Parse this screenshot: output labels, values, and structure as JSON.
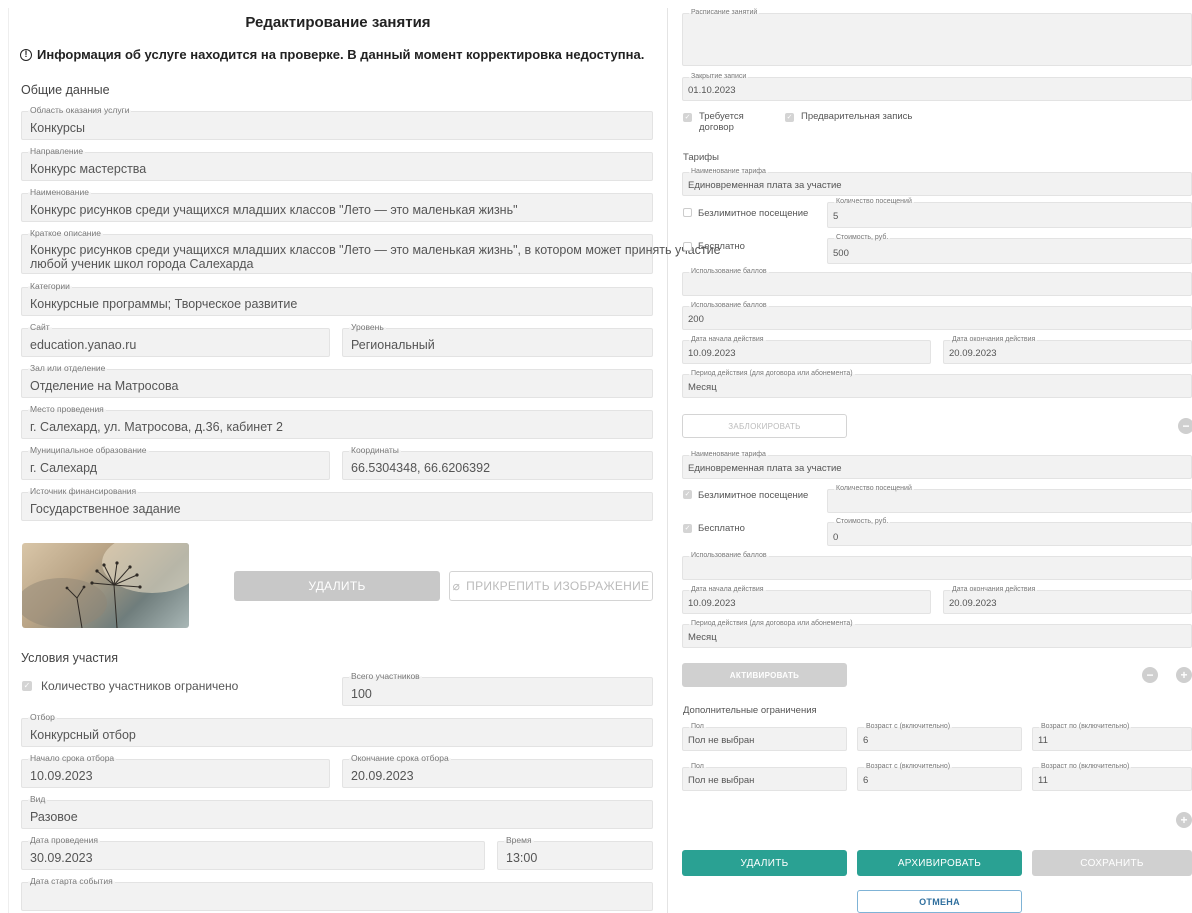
{
  "page": {
    "title": "Редактирование занятия",
    "notice": "Информация об услуге находится на проверке. В данный момент корректировка недоступна.",
    "general_section": "Общие данные",
    "conditions_section": "Условия участия"
  },
  "general": {
    "area": {
      "label": "Область оказания услуги",
      "value": "Конкурсы"
    },
    "direction": {
      "label": "Направление",
      "value": "Конкурс мастерства"
    },
    "name": {
      "label": "Наименование",
      "value": "Конкурс рисунков среди учащихся младших классов \"Лето — это маленькая жизнь\""
    },
    "short_desc": {
      "label": "Краткое описание",
      "value_line1": "Конкурс рисунков среди учащихся младших классов \"Лето — это маленькая жизнь\", в котором может принять участие",
      "value_line2": "любой ученик школ города Салехарда"
    },
    "categories": {
      "label": "Категории",
      "value": "Конкурсные программы; Творческое развитие"
    },
    "site": {
      "label": "Сайт",
      "value": "education.yanao.ru"
    },
    "level": {
      "label": "Уровень",
      "value": "Региональный"
    },
    "hall": {
      "label": "Зал или отделение",
      "value": "Отделение на Матросова"
    },
    "place": {
      "label": "Место проведения",
      "value": "г. Салехард, ул. Матросова, д.36, кабинет 2"
    },
    "municipality": {
      "label": "Муниципальное образование",
      "value": "г. Салехард"
    },
    "coords": {
      "label": "Координаты",
      "value": "66.5304348, 66.6206392"
    },
    "funding": {
      "label": "Источник финансирования",
      "value": "Государственное задание"
    }
  },
  "image_actions": {
    "delete": "УДАЛИТЬ",
    "attach": "ПРИКРЕПИТЬ ИЗОБРАЖЕНИЕ"
  },
  "conditions": {
    "limited_label": "Количество участников ограничено",
    "total": {
      "label": "Всего участников",
      "value": "100"
    },
    "selection": {
      "label": "Отбор",
      "value": "Конкурсный отбор"
    },
    "sel_start": {
      "label": "Начало срока отбора",
      "value": "10.09.2023"
    },
    "sel_end": {
      "label": "Окончание срока отбора",
      "value": "20.09.2023"
    },
    "kind": {
      "label": "Вид",
      "value": "Разовое"
    },
    "date": {
      "label": "Дата проведения",
      "value": "30.09.2023"
    },
    "time": {
      "label": "Время",
      "value": "13:00"
    },
    "start_date": {
      "label": "Дата старта события",
      "value": ""
    }
  },
  "right": {
    "schedule": {
      "label": "Расписание занятий",
      "value": ""
    },
    "close": {
      "label": "Закрытие записи",
      "value": "01.10.2023"
    },
    "contract_label_1": "Требуется",
    "contract_label_2": "договор",
    "prereg_label": "Предварительная запись",
    "tariffs_section": "Тарифы",
    "extra_section": "Дополнительные ограничения"
  },
  "tariff1": {
    "name": {
      "label": "Наименование тарифа",
      "value": "Единовременная плата за участие"
    },
    "unlimited_label": "Безлимитное посещение",
    "visits": {
      "label": "Количество посещений",
      "value": "5"
    },
    "free_label": "Бесплатно",
    "cost": {
      "label": "Стоимость, руб.",
      "value": "500"
    },
    "points_use": {
      "label": "Использование баллов",
      "value": ""
    },
    "points_use2": {
      "label": "Использование баллов",
      "value": "200"
    },
    "start": {
      "label": "Дата начала действия",
      "value": "10.09.2023"
    },
    "end": {
      "label": "Дата окончания действия",
      "value": "20.09.2023"
    },
    "period": {
      "label": "Период действия (для договора или абонемента)",
      "value": "Месяц"
    },
    "block_btn": "ЗАБЛОКИРОВАТЬ"
  },
  "tariff2": {
    "name": {
      "label": "Наименование тарифа",
      "value": "Единовременная плата за участие"
    },
    "unlimited_label": "Безлимитное посещение",
    "visits": {
      "label": "Количество посещений",
      "value": ""
    },
    "free_label": "Бесплатно",
    "cost": {
      "label": "Стоимость, руб.",
      "value": "0"
    },
    "points_use": {
      "label": "Использование баллов",
      "value": ""
    },
    "start": {
      "label": "Дата начала действия",
      "value": "10.09.2023"
    },
    "end": {
      "label": "Дата окончания действия",
      "value": "20.09.2023"
    },
    "period": {
      "label": "Период действия (для договора или абонемента)",
      "value": "Месяц"
    },
    "activate_btn": "АКТИВИРОВАТЬ"
  },
  "extra": [
    {
      "sex_label": "Пол",
      "sex": "Пол не выбран",
      "from_label": "Возраст с (включительно)",
      "from": "6",
      "to_label": "Возраст по (включительно)",
      "to": "11"
    },
    {
      "sex_label": "Пол",
      "sex": "Пол не выбран",
      "from_label": "Возраст с (включительно)",
      "from": "6",
      "to_label": "Возраст по (включительно)",
      "to": "11"
    }
  ],
  "actions": {
    "delete": "УДАЛИТЬ",
    "archive": "АРХИВИРОВАТЬ",
    "save": "СОХРАНИТЬ",
    "cancel": "ОТМЕНА"
  },
  "colors": {
    "teal": "#2aa193",
    "field_bg": "#f2f2f2"
  }
}
